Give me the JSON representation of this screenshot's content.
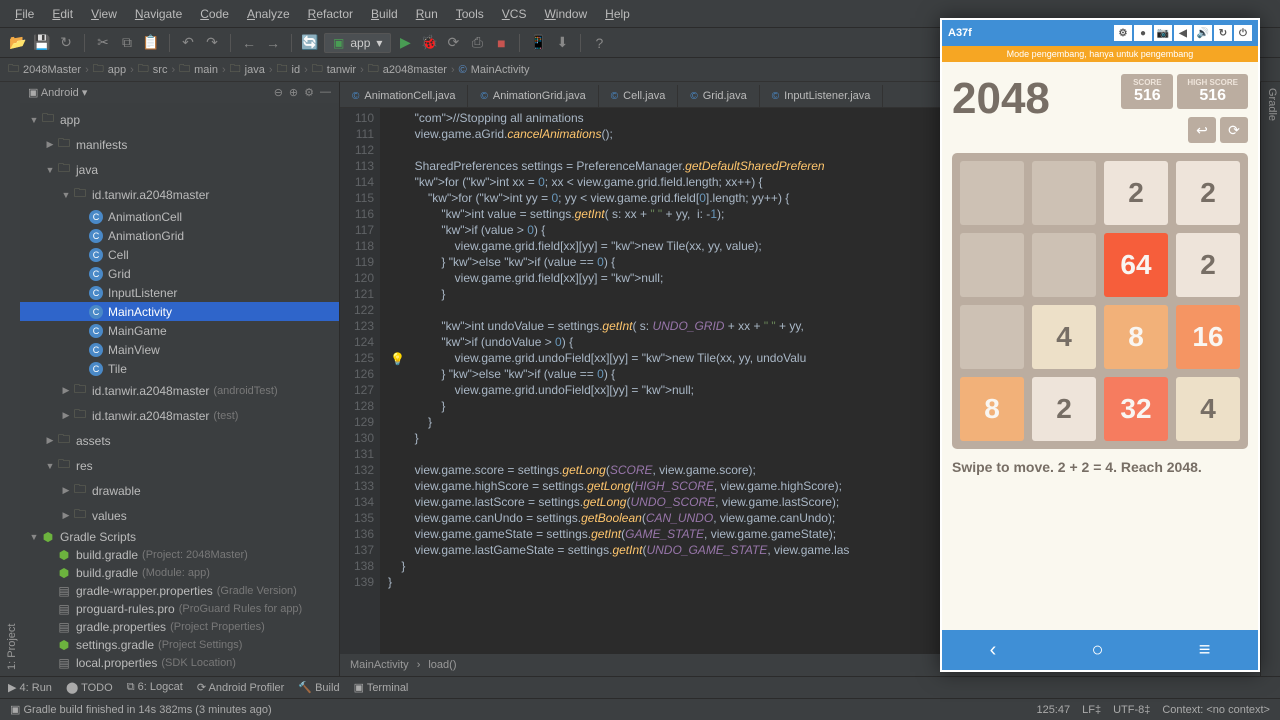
{
  "menu": [
    "File",
    "Edit",
    "View",
    "Navigate",
    "Code",
    "Analyze",
    "Refactor",
    "Build",
    "Run",
    "Tools",
    "VCS",
    "Window",
    "Help"
  ],
  "runConfig": "app",
  "breadcrumbs": [
    {
      "icon": "folder",
      "label": "2048Master"
    },
    {
      "icon": "folder",
      "label": "app"
    },
    {
      "icon": "folder",
      "label": "src"
    },
    {
      "icon": "folder",
      "label": "main"
    },
    {
      "icon": "folder",
      "label": "java"
    },
    {
      "icon": "folder",
      "label": "id"
    },
    {
      "icon": "folder",
      "label": "tanwir"
    },
    {
      "icon": "folder",
      "label": "a2048master"
    },
    {
      "icon": "class",
      "label": "MainActivity"
    }
  ],
  "projectPanel": {
    "title": "Android"
  },
  "tree": [
    {
      "depth": 0,
      "arrow": "▼",
      "icon": "folder",
      "label": "app"
    },
    {
      "depth": 1,
      "arrow": "▶",
      "icon": "folder",
      "label": "manifests"
    },
    {
      "depth": 1,
      "arrow": "▼",
      "icon": "folder",
      "label": "java"
    },
    {
      "depth": 2,
      "arrow": "▼",
      "icon": "folder",
      "label": "id.tanwir.a2048master"
    },
    {
      "depth": 3,
      "arrow": "",
      "icon": "class",
      "label": "AnimationCell"
    },
    {
      "depth": 3,
      "arrow": "",
      "icon": "class",
      "label": "AnimationGrid"
    },
    {
      "depth": 3,
      "arrow": "",
      "icon": "class",
      "label": "Cell"
    },
    {
      "depth": 3,
      "arrow": "",
      "icon": "class",
      "label": "Grid"
    },
    {
      "depth": 3,
      "arrow": "",
      "icon": "class",
      "label": "InputListener"
    },
    {
      "depth": 3,
      "arrow": "",
      "icon": "class",
      "label": "MainActivity",
      "selected": true
    },
    {
      "depth": 3,
      "arrow": "",
      "icon": "class",
      "label": "MainGame"
    },
    {
      "depth": 3,
      "arrow": "",
      "icon": "class",
      "label": "MainView"
    },
    {
      "depth": 3,
      "arrow": "",
      "icon": "class",
      "label": "Tile"
    },
    {
      "depth": 2,
      "arrow": "▶",
      "icon": "folder",
      "label": "id.tanwir.a2048master",
      "hint": "(androidTest)"
    },
    {
      "depth": 2,
      "arrow": "▶",
      "icon": "folder",
      "label": "id.tanwir.a2048master",
      "hint": "(test)"
    },
    {
      "depth": 1,
      "arrow": "▶",
      "icon": "folder",
      "label": "assets"
    },
    {
      "depth": 1,
      "arrow": "▼",
      "icon": "folder",
      "label": "res"
    },
    {
      "depth": 2,
      "arrow": "▶",
      "icon": "folder",
      "label": "drawable"
    },
    {
      "depth": 2,
      "arrow": "▶",
      "icon": "folder",
      "label": "values"
    },
    {
      "depth": 0,
      "arrow": "▼",
      "icon": "gradle",
      "label": "Gradle Scripts"
    },
    {
      "depth": 1,
      "arrow": "",
      "icon": "gradle",
      "label": "build.gradle",
      "hint": "(Project: 2048Master)"
    },
    {
      "depth": 1,
      "arrow": "",
      "icon": "gradle",
      "label": "build.gradle",
      "hint": "(Module: app)"
    },
    {
      "depth": 1,
      "arrow": "",
      "icon": "file",
      "label": "gradle-wrapper.properties",
      "hint": "(Gradle Version)"
    },
    {
      "depth": 1,
      "arrow": "",
      "icon": "file",
      "label": "proguard-rules.pro",
      "hint": "(ProGuard Rules for app)"
    },
    {
      "depth": 1,
      "arrow": "",
      "icon": "file",
      "label": "gradle.properties",
      "hint": "(Project Properties)"
    },
    {
      "depth": 1,
      "arrow": "",
      "icon": "gradle",
      "label": "settings.gradle",
      "hint": "(Project Settings)"
    },
    {
      "depth": 1,
      "arrow": "",
      "icon": "file",
      "label": "local.properties",
      "hint": "(SDK Location)"
    }
  ],
  "editorTabs": [
    "AnimationCell.java",
    "AnimationGrid.java",
    "Cell.java",
    "Grid.java",
    "InputListener.java"
  ],
  "gutterStart": 110,
  "codeLines": [
    "        //Stopping all animations",
    "        view.game.aGrid.cancelAnimations();",
    "",
    "        SharedPreferences settings = PreferenceManager.getDefaultSharedPreferen",
    "        for (int xx = 0; xx < view.game.grid.field.length; xx++) {",
    "            for (int yy = 0; yy < view.game.grid.field[0].length; yy++) {",
    "                int value = settings.getInt( s: xx + \" \" + yy,  i: -1);",
    "                if (value > 0) {",
    "                    view.game.grid.field[xx][yy] = new Tile(xx, yy, value);",
    "                } else if (value == 0) {",
    "                    view.game.grid.field[xx][yy] = null;",
    "                }",
    "",
    "                int undoValue = settings.getInt( s: UNDO_GRID + xx + \" \" + yy,  ",
    "                if (undoValue > 0) {",
    "                    view.game.grid.undoField[xx][yy] = new Tile(xx, yy, undoValu",
    "                } else if (value == 0) {",
    "                    view.game.grid.undoField[xx][yy] = null;",
    "                }",
    "            }",
    "        }",
    "",
    "        view.game.score = settings.getLong(SCORE, view.game.score);",
    "        view.game.highScore = settings.getLong(HIGH_SCORE, view.game.highScore);",
    "        view.game.lastScore = settings.getLong(UNDO_SCORE, view.game.lastScore);",
    "        view.game.canUndo = settings.getBoolean(CAN_UNDO, view.game.canUndo);",
    "        view.game.gameState = settings.getInt(GAME_STATE, view.game.gameState);",
    "        view.game.lastGameState = settings.getInt(UNDO_GAME_STATE, view.game.las",
    "    }",
    "}"
  ],
  "editorCrumb": [
    "MainActivity",
    "load()"
  ],
  "bottomTabs": [
    "▶ 4: Run",
    "⬤ TODO",
    "⧉ 6: Logcat",
    "⟳ Android Profiler",
    "🔨 Build",
    "▣ Terminal"
  ],
  "status": {
    "msg": "Gradle build finished in 14s 382ms (3 minutes ago)",
    "pos": "125:47",
    "lf": "LF‡",
    "enc": "UTF-8‡",
    "ctx": "Context: <no context>"
  },
  "emulator": {
    "title": "A37f",
    "devMode": "Mode pengembang, hanya untuk pengembang",
    "gameTitle": "2048",
    "scoreLabel": "SCORE",
    "score": "516",
    "highScoreLabel": "HIGH SCORE",
    "highScore": "516",
    "hint": "Swipe to move. 2 + 2 = 4. Reach 2048.",
    "grid": [
      [
        "",
        "",
        "2",
        "2"
      ],
      [
        "",
        "",
        "64",
        "2"
      ],
      [
        "",
        "4",
        "8",
        "16"
      ],
      [
        "8",
        "2",
        "32",
        "4"
      ]
    ]
  }
}
